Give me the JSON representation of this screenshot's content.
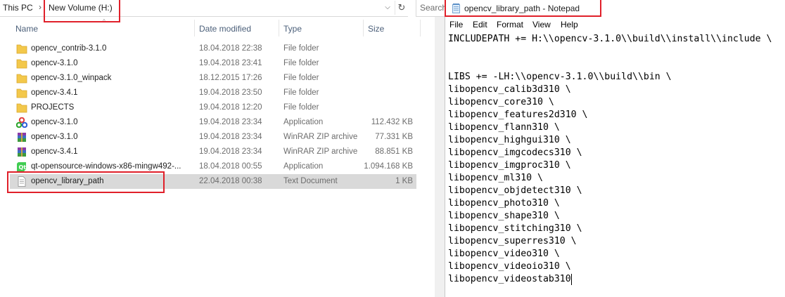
{
  "explorer": {
    "breadcrumb": [
      "This PC",
      "New Volume (H:)"
    ],
    "breadcrumb_sep": "›",
    "search_placeholder": "Search",
    "columns": {
      "name": "Name",
      "date": "Date modified",
      "type": "Type",
      "size": "Size"
    },
    "files": [
      {
        "name": "opencv_contrib-3.1.0",
        "date": "18.04.2018 22:38",
        "type": "File folder",
        "size": "",
        "icon": "folder-icon"
      },
      {
        "name": "opencv-3.1.0",
        "date": "19.04.2018 23:41",
        "type": "File folder",
        "size": "",
        "icon": "folder-icon"
      },
      {
        "name": "opencv-3.1.0_winpack",
        "date": "18.12.2015 17:26",
        "type": "File folder",
        "size": "",
        "icon": "folder-icon"
      },
      {
        "name": "opencv-3.4.1",
        "date": "19.04.2018 23:50",
        "type": "File folder",
        "size": "",
        "icon": "folder-icon"
      },
      {
        "name": "PROJECTS",
        "date": "19.04.2018 12:20",
        "type": "File folder",
        "size": "",
        "icon": "folder-icon"
      },
      {
        "name": "opencv-3.1.0",
        "date": "19.04.2018 23:34",
        "type": "Application",
        "size": "112.432 KB",
        "icon": "opencv-app-icon"
      },
      {
        "name": "opencv-3.1.0",
        "date": "19.04.2018 23:34",
        "type": "WinRAR ZIP archive",
        "size": "77.331 KB",
        "icon": "winrar-archive-icon"
      },
      {
        "name": "opencv-3.4.1",
        "date": "19.04.2018 23:34",
        "type": "WinRAR ZIP archive",
        "size": "88.851 KB",
        "icon": "winrar-archive-icon"
      },
      {
        "name": "qt-opensource-windows-x86-mingw492-...",
        "date": "18.04.2018 00:55",
        "type": "Application",
        "size": "1.094.168 KB",
        "icon": "qt-app-icon"
      },
      {
        "name": "opencv_library_path",
        "date": "22.04.2018 00:38",
        "type": "Text Document",
        "size": "1 KB",
        "icon": "text-document-icon",
        "selected": true
      }
    ]
  },
  "notepad": {
    "title": "opencv_library_path - Notepad",
    "menu": [
      "File",
      "Edit",
      "Format",
      "View",
      "Help"
    ],
    "lines": [
      "INCLUDEPATH += H:\\\\opencv-3.1.0\\\\build\\\\install\\\\include \\",
      "",
      "",
      "LIBS += -LH:\\\\opencv-3.1.0\\\\build\\\\bin \\",
      "libopencv_calib3d310 \\",
      "libopencv_core310 \\",
      "libopencv_features2d310 \\",
      "libopencv_flann310 \\",
      "libopencv_highgui310 \\",
      "libopencv_imgcodecs310 \\",
      "libopencv_imgproc310 \\",
      "libopencv_ml310 \\",
      "libopencv_objdetect310 \\",
      "libopencv_photo310 \\",
      "libopencv_shape310 \\",
      "libopencv_stitching310 \\",
      "libopencv_superres310 \\",
      "libopencv_video310 \\",
      "libopencv_videoio310 \\",
      "libopencv_videostab310"
    ]
  },
  "colors": {
    "highlight_box": "#e0202a",
    "selected_row": "#d9d9d9",
    "folder": "#f3c84b"
  }
}
